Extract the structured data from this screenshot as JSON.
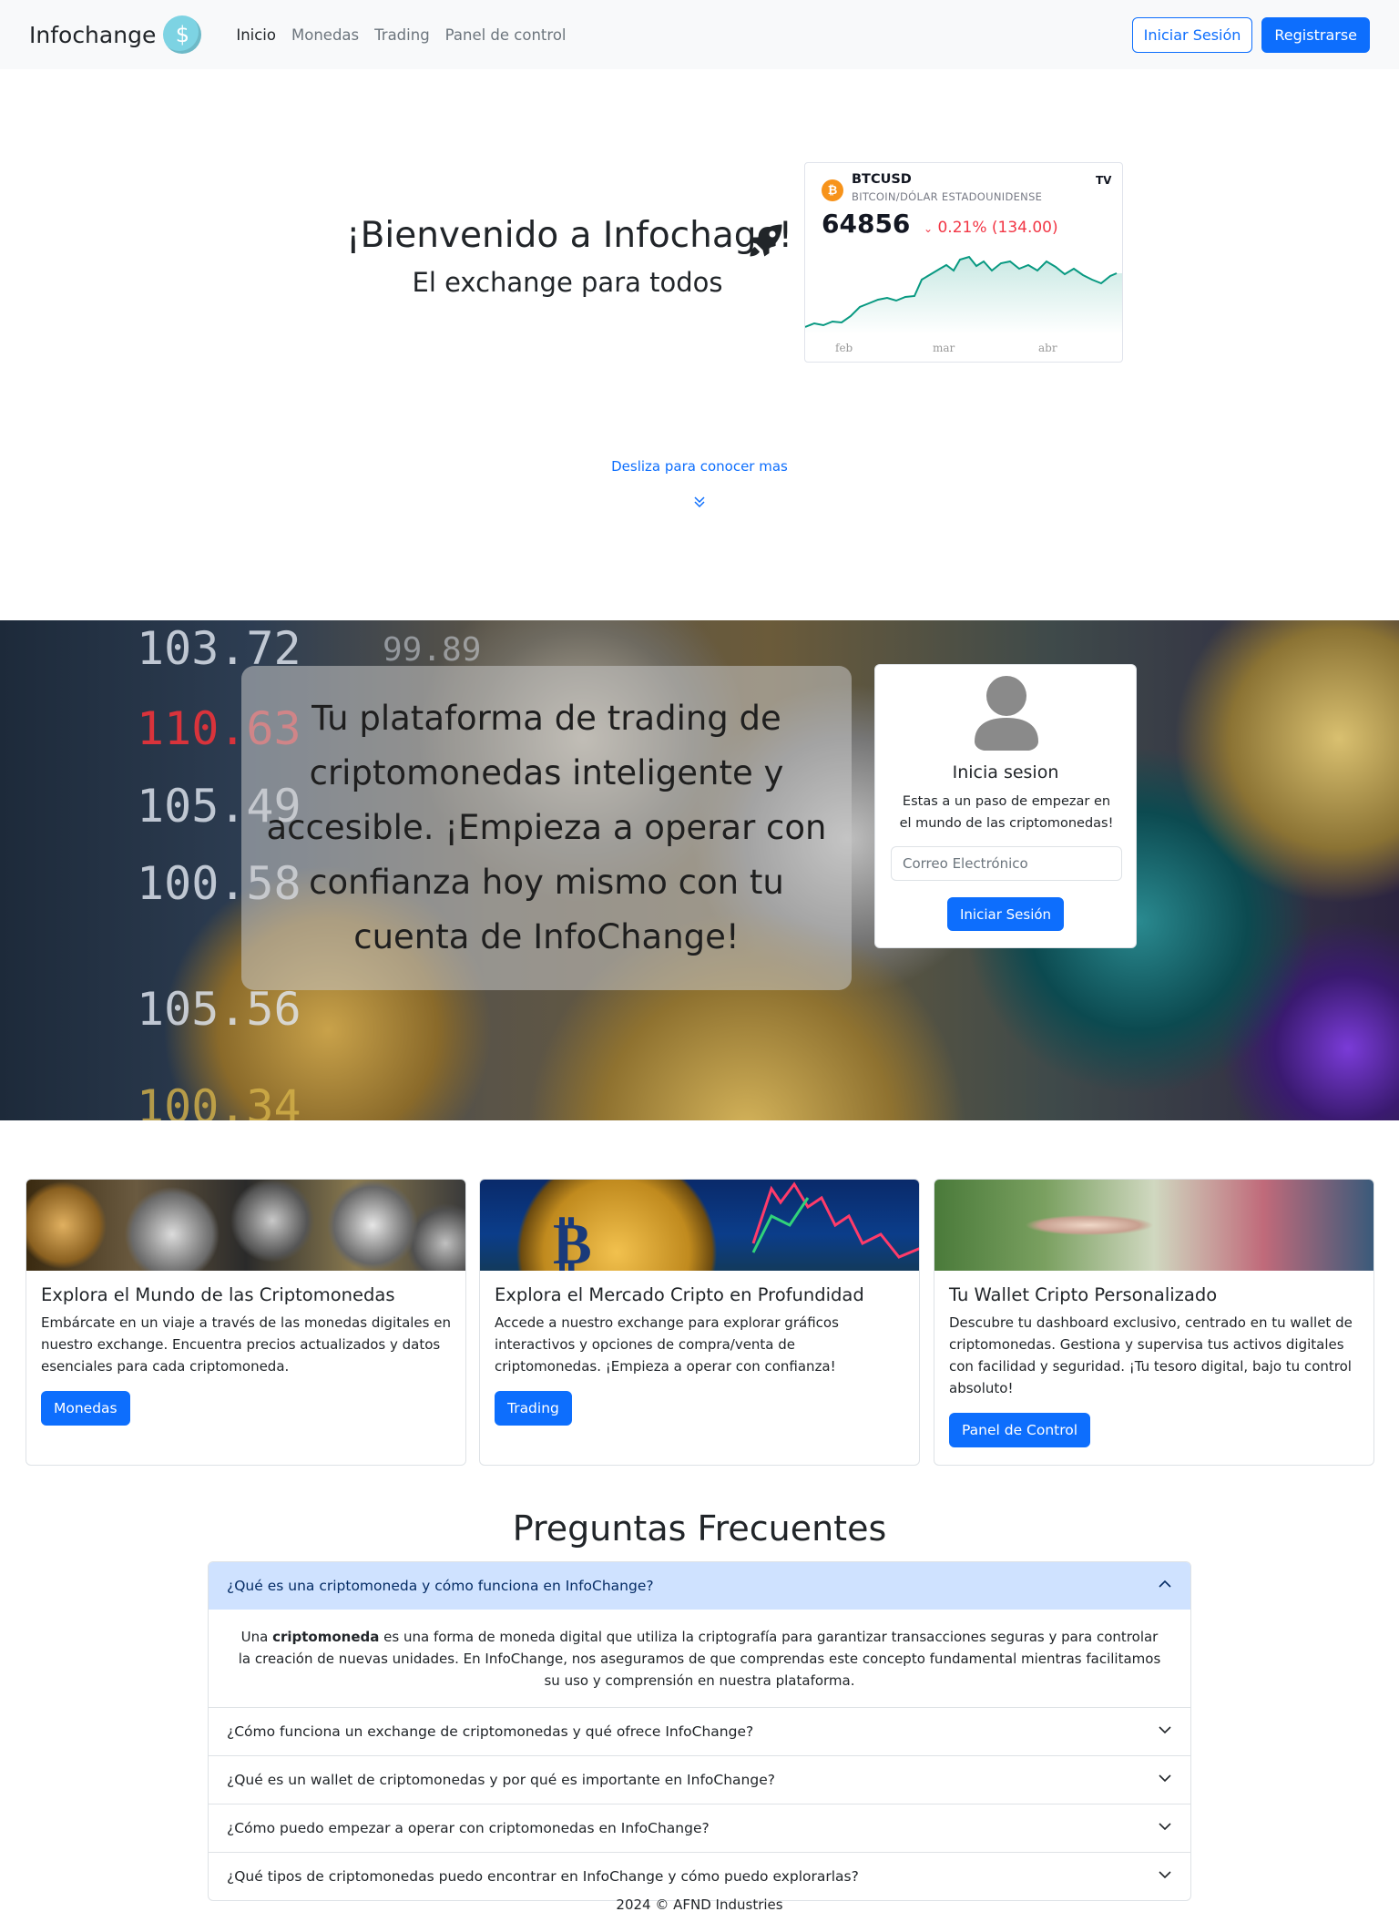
{
  "navbar": {
    "brand": "Infochange",
    "brand_icon": "dollar-coin-icon",
    "links": [
      "Inicio",
      "Monedas",
      "Trading",
      "Panel de control"
    ],
    "login_label": "Iniciar Sesión",
    "register_label": "Registrarse"
  },
  "hero": {
    "title": "¡Bienvenido a Infochage!",
    "subtitle": "El exchange para todos",
    "scroll_hint": "Desliza para conocer mas"
  },
  "ticker": {
    "symbol": "BTCUSD",
    "name": "BITCOIN/DÓLAR ESTADOUNIDENSE",
    "price": "64856",
    "change": "0.21% (134.00)",
    "months": [
      "feb",
      "mar",
      "abr"
    ],
    "line_color": "#089981",
    "change_color": "#f23645"
  },
  "banner": {
    "numbers": [
      "103.72",
      "99.89",
      "110.63",
      "105.49",
      "100.58",
      "105.56",
      "100.34"
    ],
    "text": "Tu plataforma de trading de criptomonedas inteligente y accesible. ¡Empieza a operar con confianza hoy mismo con tu cuenta de InfoChange!",
    "login": {
      "title": "Inicia sesion",
      "description": "Estas a un paso de empezar en el mundo de las criptomonedas!",
      "email_placeholder": "Correo Electrónico",
      "button": "Iniciar Sesión"
    }
  },
  "cards": [
    {
      "title": "Explora el Mundo de las Criptomonedas",
      "text": "Embárcate en un viaje a través de las monedas digitales en nuestro exchange. Encuentra precios actualizados y datos esenciales para cada criptomoneda.",
      "button": "Monedas"
    },
    {
      "title": "Explora el Mercado Cripto en Profundidad",
      "text": "Accede a nuestro exchange para explorar gráficos interactivos y opciones de compra/venta de criptomonedas. ¡Empieza a operar con confianza!",
      "button": "Trading"
    },
    {
      "title": "Tu Wallet Cripto Personalizado",
      "text": "Descubre tu dashboard exclusivo, centrado en tu wallet de criptomonedas. Gestiona y supervisa tus activos digitales con facilidad y seguridad. ¡Tu tesoro digital, bajo tu control absoluto!",
      "button": "Panel de Control"
    }
  ],
  "faq": {
    "title": "Preguntas Frecuentes",
    "items": [
      {
        "question": "¿Qué es una criptomoneda y cómo funciona en InfoChange?",
        "answer_prefix": "Una ",
        "answer_bold": "criptomoneda",
        "answer_rest": " es una forma de moneda digital que utiliza la criptografía para garantizar transacciones seguras y para controlar la creación de nuevas unidades. En InfoChange, nos aseguramos de que comprendas este concepto fundamental mientras facilitamos su uso y comprensión en nuestra plataforma."
      },
      {
        "question": "¿Cómo funciona un exchange de criptomonedas y qué ofrece InfoChange?"
      },
      {
        "question": "¿Qué es un wallet de criptomonedas y por qué es importante en InfoChange?"
      },
      {
        "question": "¿Cómo puedo empezar a operar con criptomonedas en InfoChange?"
      },
      {
        "question": "¿Qué tipos de criptomonedas puedo encontrar en InfoChange y cómo puedo explorarlas?"
      }
    ]
  },
  "footer": "2024 © AFND Industries"
}
